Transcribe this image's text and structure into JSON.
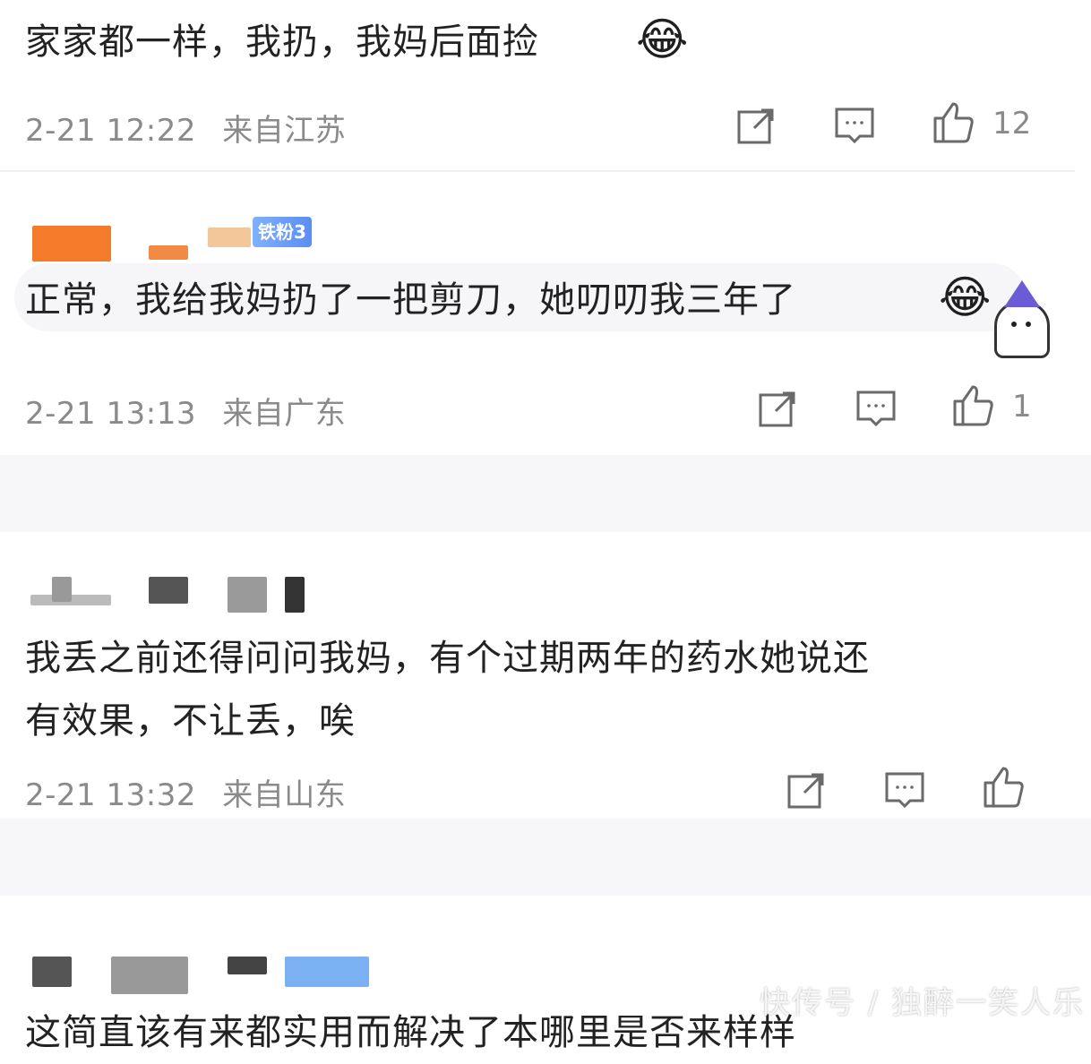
{
  "comments": [
    {
      "text": "家家都一样，我扔，我妈后面捡",
      "emoji": "😂",
      "time": "2-21 12:22",
      "location": "来自江苏",
      "likes": "12"
    },
    {
      "badge": "铁粉3",
      "text": "正常，我给我妈扔了一把剪刀，她叨叨我三年了",
      "emoji": "😂",
      "time": "2-21 13:13",
      "location": "来自广东",
      "likes": "1"
    },
    {
      "text_line1": "我丢之前还得问问我妈，有个过期两年的药水她说还",
      "text_line2": "有效果，不让丢，唉",
      "time": "2-21 13:32",
      "location": "来自山东",
      "likes": ""
    },
    {
      "text_partial": "这简直该有来都实用而解决了本哪里是否来样样"
    }
  ],
  "watermark": "快传号 / 独醉一笑人乐",
  "icons": {
    "share": "share-icon",
    "reply": "comment-icon",
    "like": "thumbs-up-icon"
  },
  "colors": {
    "text": "#222222",
    "meta": "#8a8a8a",
    "badge": "#5a8ef2"
  }
}
